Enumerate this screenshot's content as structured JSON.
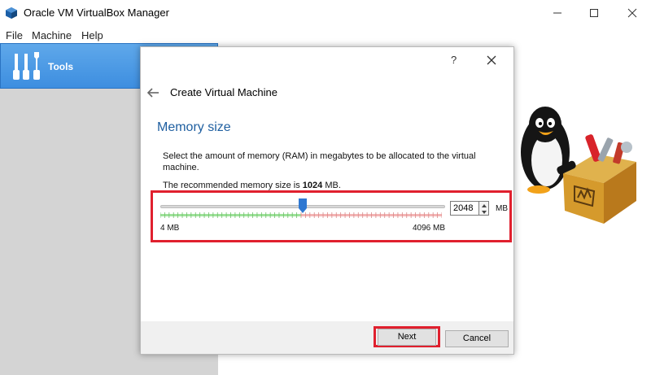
{
  "window": {
    "title": "Oracle VM VirtualBox Manager"
  },
  "menu": [
    "File",
    "Machine",
    "Help"
  ],
  "sidebar": {
    "tools_label": "Tools"
  },
  "dialog": {
    "help_label": "?",
    "title": "Create Virtual Machine",
    "heading": "Memory size",
    "description": "Select the amount of memory (RAM) in megabytes to be allocated to the virtual machine.",
    "recommend_prefix": "The recommended memory size is ",
    "recommend_value": "1024",
    "recommend_suffix": " MB.",
    "memory": {
      "value": "2048",
      "unit": "MB",
      "min_label": "4 MB",
      "max_label": "4096 MB",
      "min": 4,
      "max": 4096,
      "slider_value": 2048
    },
    "buttons": {
      "next": "Next",
      "cancel": "Cancel"
    }
  },
  "colors": {
    "accent": "#1f5fa0",
    "highlight": "#e0202e",
    "sidebar_selected": "#4a9be6"
  }
}
